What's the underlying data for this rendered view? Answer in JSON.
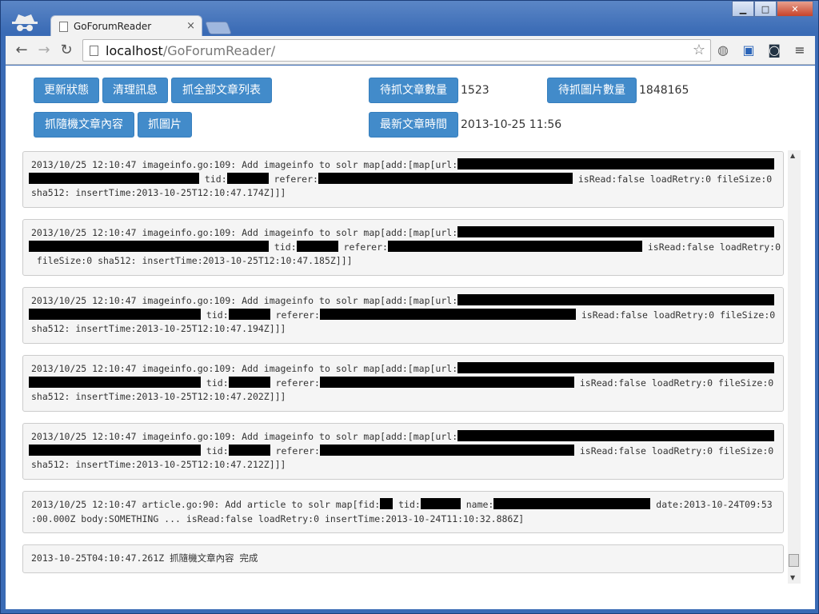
{
  "browser": {
    "tab_title": "GoForumReader",
    "tab_close": "×",
    "url_host": "localhost",
    "url_path": "/GoForumReader/"
  },
  "buttons": {
    "update_status": "更新狀態",
    "clear_messages": "清理訊息",
    "fetch_all_lists": "抓全部文章列表",
    "fetch_random_content": "抓隨機文章內容",
    "fetch_images": "抓圖片",
    "pending_articles": "待抓文章數量",
    "pending_images": "待抓圖片數量",
    "latest_article_time": "最新文章時間"
  },
  "stats": {
    "pending_articles_value": "1523",
    "pending_images_value": "1848165",
    "latest_article_time_value": "2013-10-25 11:56"
  },
  "log": {
    "e1": {
      "l1": "2013/10/25 12:10:47 imageinfo.go:109: Add imageinfo to solr map[add:[map[url:",
      "l2a": " tid:",
      "l2b": " referer:",
      "l2c": " isRead:false loadRetry:0 fileSize:0",
      "l3": "sha512: insertTime:2013-10-25T12:10:47.174Z]]]"
    },
    "e2": {
      "l1": "2013/10/25 12:10:47 imageinfo.go:109: Add imageinfo to solr map[add:[map[url:",
      "l2a": " tid:",
      "l2b": " referer:",
      "l2c": " isRead:false loadRetry:0",
      "l3": " fileSize:0 sha512: insertTime:2013-10-25T12:10:47.185Z]]]"
    },
    "e3": {
      "l1": "2013/10/25 12:10:47 imageinfo.go:109: Add imageinfo to solr map[add:[map[url:",
      "l2a": " tid:",
      "l2b": " referer:",
      "l2c": " isRead:false loadRetry:0 fileSize:0",
      "l3": "sha512: insertTime:2013-10-25T12:10:47.194Z]]]"
    },
    "e4": {
      "l1": "2013/10/25 12:10:47 imageinfo.go:109: Add imageinfo to solr map[add:[map[url:",
      "l2a": " tid:",
      "l2b": " referer:",
      "l2c": " isRead:false loadRetry:0 fileSize:0",
      "l3": "sha512: insertTime:2013-10-25T12:10:47.202Z]]]"
    },
    "e5": {
      "l1": "2013/10/25 12:10:47 imageinfo.go:109: Add imageinfo to solr map[add:[map[url:",
      "l2a": " tid:",
      "l2b": " referer:",
      "l2c": " isRead:false loadRetry:0 fileSize:0",
      "l3": "sha512: insertTime:2013-10-25T12:10:47.212Z]]]"
    },
    "e6": {
      "l1a": "2013/10/25 12:10:47 article.go:90: Add article to solr map[fid:",
      "l1b": " tid:",
      "l1c": " name:",
      "l1d": " date:2013-10-24T09:53",
      "l2": ":00.000Z body:SOMETHING ... isRead:false loadRetry:0 insertTime:2013-10-24T11:10:32.886Z]"
    },
    "e7": {
      "l1": "2013-10-25T04:10:47.261Z 抓隨機文章內容 完成"
    }
  }
}
